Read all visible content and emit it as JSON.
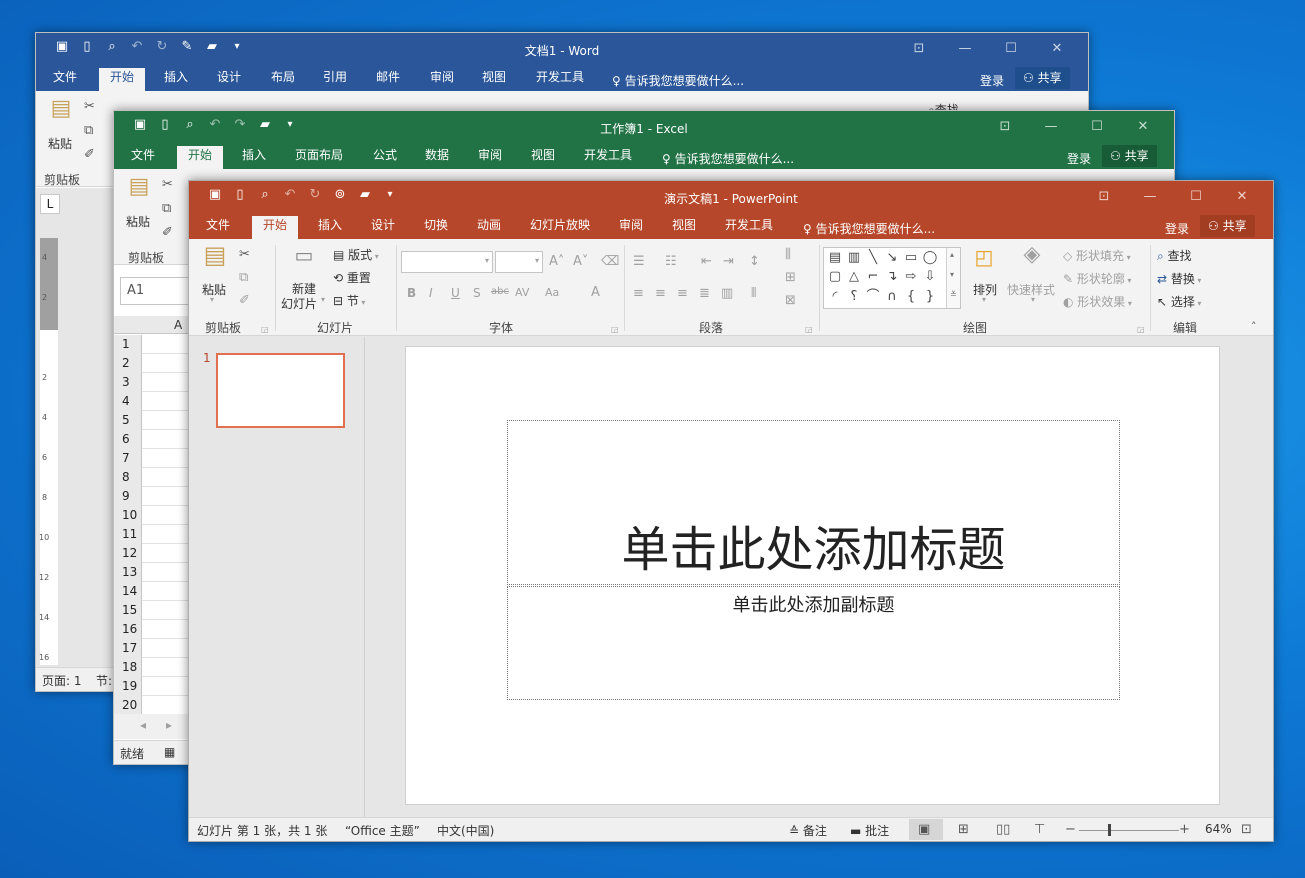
{
  "word": {
    "title": "文档1 - Word",
    "tabs": [
      "文件",
      "开始",
      "插入",
      "设计",
      "布局",
      "引用",
      "邮件",
      "审阅",
      "视图",
      "开发工具"
    ],
    "tell_me": "告诉我您想要做什么...",
    "login": "登录",
    "share": "共享",
    "paste": "粘贴",
    "clipboard": "剪贴板",
    "find": "查找",
    "status_page": "页面: 1",
    "status_section": "节:",
    "ruler_corner": "L",
    "ruler_numbers": [
      "4",
      "2",
      "2",
      "4",
      "6",
      "8",
      "10",
      "12",
      "14",
      "16"
    ]
  },
  "excel": {
    "title": "工作簿1 - Excel",
    "tabs": [
      "文件",
      "开始",
      "插入",
      "页面布局",
      "公式",
      "数据",
      "审阅",
      "视图",
      "开发工具"
    ],
    "tell_me": "告诉我您想要做什么...",
    "login": "登录",
    "share": "共享",
    "paste": "粘贴",
    "clipboard": "剪贴板",
    "name_box": "A1",
    "col_a": "A",
    "rows": [
      "1",
      "2",
      "3",
      "4",
      "5",
      "6",
      "7",
      "8",
      "9",
      "10",
      "11",
      "12",
      "13",
      "14",
      "15",
      "16",
      "17",
      "18",
      "19",
      "20"
    ],
    "status": "就绪"
  },
  "ppt": {
    "title": "演示文稿1 - PowerPoint",
    "tabs": [
      "文件",
      "开始",
      "插入",
      "设计",
      "切换",
      "动画",
      "幻灯片放映",
      "审阅",
      "视图",
      "开发工具"
    ],
    "tell_me": "告诉我您想要做什么...",
    "login": "登录",
    "share": "共享",
    "ribbon": {
      "paste": "粘贴",
      "clipboard": "剪贴板",
      "new_slide_1": "新建",
      "new_slide_2": "幻灯片",
      "layout": "版式",
      "reset": "重置",
      "section": "节",
      "slides": "幻灯片",
      "font_group": "字体",
      "paragraph": "段落",
      "arrange": "排列",
      "quick_styles": "快速样式",
      "shape_fill": "形状填充",
      "shape_outline": "形状轮廓",
      "shape_effects": "形状效果",
      "drawing": "绘图",
      "find": "查找",
      "replace": "替换",
      "select": "选择",
      "editing": "编辑",
      "bold": "B",
      "italic": "I",
      "underline": "U",
      "shadow": "S",
      "strike": "abc",
      "spacing": "AV",
      "case": "Aa",
      "fontcolor": "A"
    },
    "thumb_number": "1",
    "slide_title": "单击此处添加标题",
    "slide_subtitle": "单击此处添加副标题",
    "status": {
      "slide_info": "幻灯片 第 1 张，共 1 张",
      "theme": "“Office 主题”",
      "language": "中文(中国)",
      "notes": "备注",
      "comments": "批注",
      "zoom": "64%"
    },
    "accent": "#b7472a"
  },
  "colors": {
    "word": "#2b579a",
    "excel": "#217346",
    "powerpoint": "#b7472a"
  }
}
